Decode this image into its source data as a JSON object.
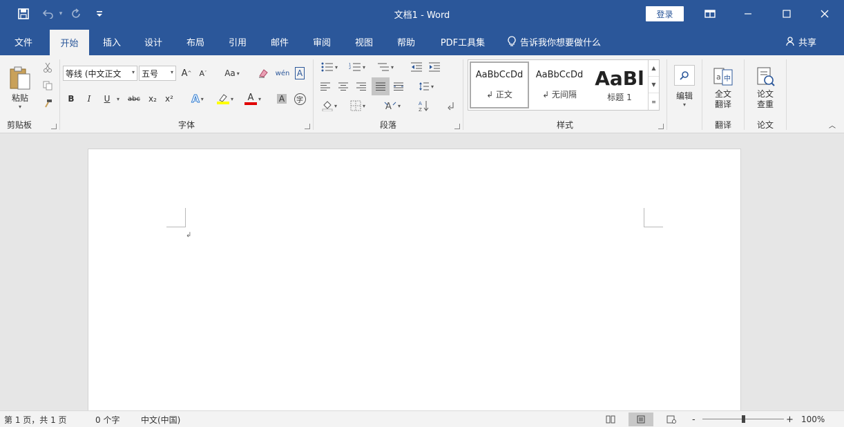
{
  "titlebar": {
    "title": "文档1 - Word",
    "login_label": "登录",
    "save_icon": "save-icon",
    "undo_icon": "undo-icon",
    "redo_icon": "redo-icon",
    "customize_icon": "customize-qat-icon"
  },
  "tabs": [
    "文件",
    "开始",
    "插入",
    "设计",
    "布局",
    "引用",
    "邮件",
    "审阅",
    "视图",
    "帮助",
    "PDF工具集"
  ],
  "active_tab": "开始",
  "tellme": "告诉我你想要做什么",
  "share": "共享",
  "ribbon": {
    "clipboard": {
      "paste": "粘贴",
      "label": "剪贴板"
    },
    "font": {
      "font_name": "等线 (中文正文",
      "font_size": "五号",
      "label": "字体",
      "case": "Aa",
      "bold": "B",
      "italic": "I",
      "underline": "U",
      "strike": "abc",
      "sub": "x₂",
      "sup": "x²"
    },
    "paragraph": {
      "label": "段落"
    },
    "styles": {
      "label": "样式",
      "items": [
        {
          "preview": "AaBbCcDd",
          "name": "↲ 正文"
        },
        {
          "preview": "AaBbCcDd",
          "name": "↲ 无间隔"
        },
        {
          "preview": "AaBl",
          "name": "标题 1"
        }
      ]
    },
    "editing": {
      "label": "编辑"
    },
    "translate": {
      "button": "全文\n翻译",
      "label": "翻译"
    },
    "thesis": {
      "button": "论文\n查重",
      "label": "论文"
    }
  },
  "status": {
    "page": "第 1 页，共 1 页",
    "words": "0 个字",
    "language": "中文(中国)",
    "zoom": "100%",
    "zoom_fraction": 0.5
  },
  "colors": {
    "accent": "#2b579a",
    "ribbon_bg": "#f3f3f3",
    "canvas_bg": "#e6e6e6"
  }
}
